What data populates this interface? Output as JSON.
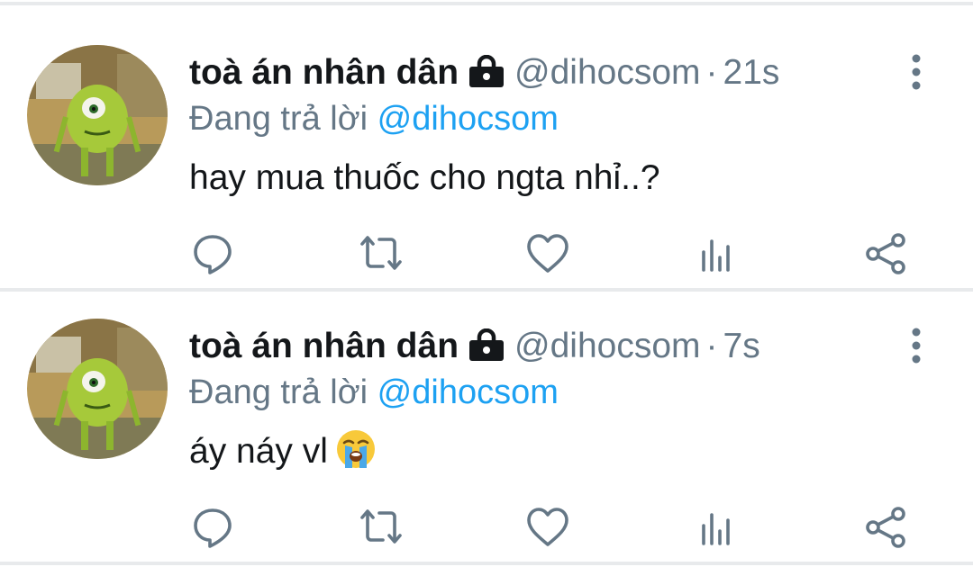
{
  "colors": {
    "text_primary": "#14171a",
    "text_secondary": "#657786",
    "link": "#1da1f2",
    "icon": "#657786",
    "divider": "#e8eaec"
  },
  "tweets": [
    {
      "display_name": "toà án nhân dân",
      "handle": "@dihocsom",
      "separator": "·",
      "time": "21s",
      "reply_label": "Đang trả lời",
      "reply_to": "@dihocsom",
      "text": "hay mua thuốc cho ngta nhỉ..?",
      "emoji": null,
      "icons": {
        "lock": "lock-icon",
        "more": "more-vertical-icon",
        "reply": "reply-icon",
        "retweet": "retweet-icon",
        "like": "heart-icon",
        "analytics": "analytics-icon",
        "share": "share-icon"
      }
    },
    {
      "display_name": "toà án nhân dân",
      "handle": "@dihocsom",
      "separator": "·",
      "time": "7s",
      "reply_label": "Đang trả lời",
      "reply_to": "@dihocsom",
      "text": "áy náy vl",
      "emoji": "loudly-crying-face-emoji",
      "icons": {
        "lock": "lock-icon",
        "more": "more-vertical-icon",
        "reply": "reply-icon",
        "retweet": "retweet-icon",
        "like": "heart-icon",
        "analytics": "analytics-icon",
        "share": "share-icon"
      }
    }
  ]
}
